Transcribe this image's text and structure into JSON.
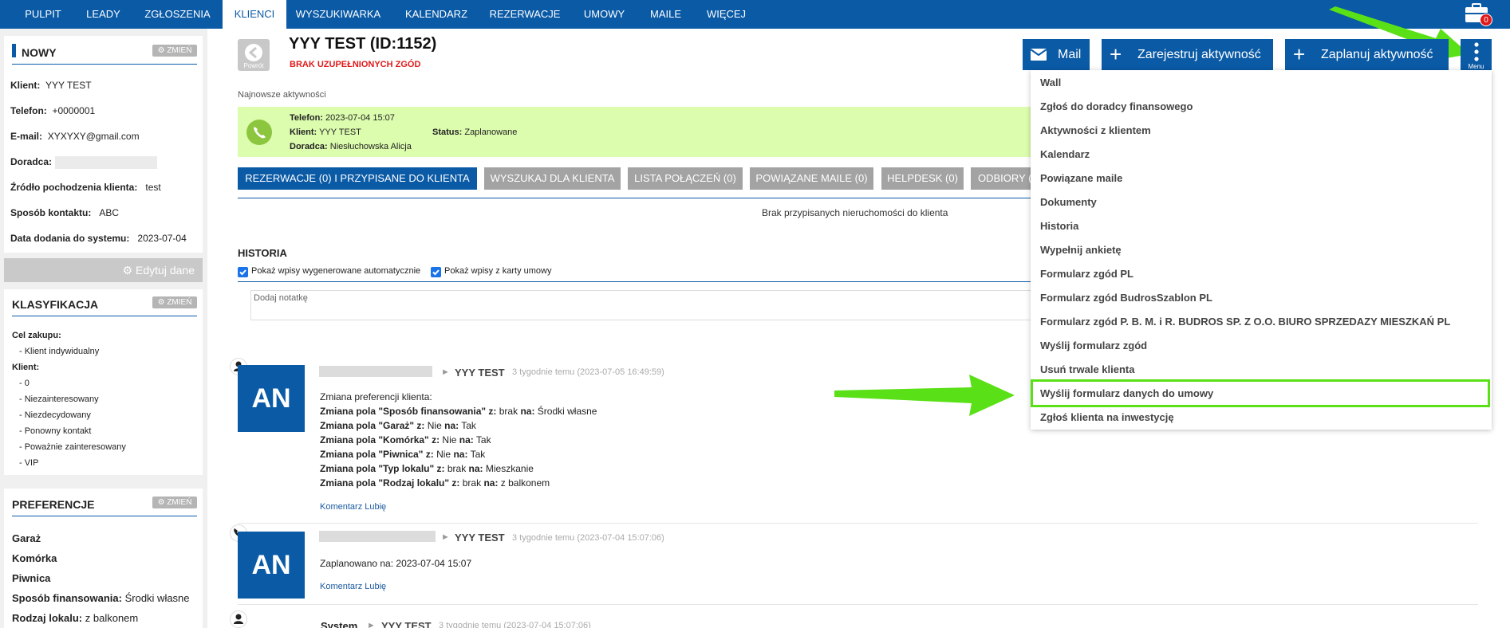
{
  "nav": {
    "items": [
      "PULPIT",
      "LEADY",
      "ZGŁOSZENIA",
      "KLIENCI",
      "WYSZUKIWARKA",
      "KALENDARZ",
      "REZERWACJE",
      "UMOWY",
      "MAILE",
      "WIĘCEJ"
    ],
    "active": "KLIENCI",
    "notifications": "0"
  },
  "sidebar": {
    "status": {
      "title": "NOWY",
      "change_label": "ZMIEŃ"
    },
    "fields": [
      {
        "label": "Klient:",
        "value": "YYY TEST"
      },
      {
        "label": "Telefon:",
        "value": "+0000001"
      },
      {
        "label": "E-mail:",
        "value": "XYXYXY@gmail.com"
      },
      {
        "label": "Doradca:",
        "value": ""
      },
      {
        "label": "Źródło pochodzenia klienta:",
        "value": "test"
      },
      {
        "label": "Sposób kontaktu:",
        "value": "ABC"
      },
      {
        "label": "Data dodania do systemu:",
        "value": "2023-07-04"
      }
    ],
    "edit_label": "Edytuj dane",
    "classification": {
      "title": "KLASYFIKACJA",
      "change_label": "ZMIEŃ",
      "cel_label": "Cel zakupu:",
      "cel_items": [
        "- Klient indywidualny"
      ],
      "klient_label": "Klient:",
      "klient_items": [
        "- 0",
        "- Niezainteresowany",
        "- Niezdecydowany",
        "- Ponowny kontakt",
        "- Poważnie zainteresowany",
        "- VIP"
      ]
    },
    "preferences": {
      "title": "PREFERENCJE",
      "change_label": "ZMIEŃ",
      "items": [
        {
          "label": "Garaż",
          "value": ""
        },
        {
          "label": "Komórka",
          "value": ""
        },
        {
          "label": "Piwnica",
          "value": ""
        },
        {
          "label": "Sposób finansowania:",
          "value": "Środki własne"
        },
        {
          "label": "Rodzaj lokalu:",
          "value": "z balkonem"
        }
      ]
    }
  },
  "header": {
    "back_label": "Powrót",
    "title": "YYY TEST (ID:1152)",
    "consent_warning": "BRAK UZUPEŁNIONYCH ZGÓD",
    "mail_label": "Mail",
    "register_label": "Zarejestruj aktywność",
    "plan_label": "Zaplanuj aktywność",
    "menu_label": "Menu"
  },
  "latest": {
    "section_label": "Najnowsze aktywności",
    "telefon_label": "Telefon:",
    "telefon_value": "2023-07-04 15:07",
    "klient_label": "Klient:",
    "klient_value": "YYY TEST",
    "status_label": "Status:",
    "status_value": "Zaplanowane",
    "doradca_label": "Doradca:",
    "doradca_value": "Niesłuchowska Alicja"
  },
  "tabs": [
    "REZERWACJE (0) I PRZYPISANE DO KLIENTA",
    "WYSZUKAJ DLA KLIENTA",
    "LISTA POŁĄCZEŃ (0)",
    "POWIĄZANE MAILE (0)",
    "HELPDESK (0)",
    "ODBIORY ("
  ],
  "no_properties": "Brak przypisanych nieruchomości do klienta",
  "history": {
    "title": "HISTORIA",
    "check_auto": "Pokaż wpisy wygenerowane automatycznie",
    "check_contract": "Pokaż wpisy z karty umowy",
    "note_placeholder": "Dodaj notatkę",
    "entries": [
      {
        "avatar": "AN",
        "target": "YYY TEST",
        "time": "3 tygodnie temu (2023-07-05 16:49:59)",
        "intro": "Zmiana preferencji klienta:",
        "changes": [
          {
            "field": "Zmiana pola \"Sposób finansowania\" z:",
            "from": "brak",
            "to": "Środki własne"
          },
          {
            "field": "Zmiana pola \"Garaż\" z:",
            "from": "Nie",
            "to": "Tak"
          },
          {
            "field": "Zmiana pola \"Komórka\" z:",
            "from": "Nie",
            "to": "Tak"
          },
          {
            "field": "Zmiana pola \"Piwnica\" z:",
            "from": "Nie",
            "to": "Tak"
          },
          {
            "field": "Zmiana pola \"Typ lokalu\" z:",
            "from": "brak",
            "to": "Mieszkanie"
          },
          {
            "field": "Zmiana pola \"Rodzaj lokalu\" z:",
            "from": "brak",
            "to": "z balkonem"
          }
        ],
        "na_label": "na:",
        "links": "Komentarz Lubię"
      },
      {
        "avatar": "AN",
        "target": "YYY TEST",
        "time": "3 tygodnie temu (2023-07-04 15:07:06)",
        "text": "Zaplanowano na: 2023-07-04 15:07",
        "links": "Komentarz Lubię"
      },
      {
        "author": "System",
        "target": "YYY TEST",
        "time": "3 tygodnie temu (2023-07-04 15:07:06)"
      }
    ]
  },
  "menu": {
    "items": [
      "Wall",
      "Zgłoś do doradcy finansowego",
      "Aktywności z klientem",
      "Kalendarz",
      "Powiązane maile",
      "Dokumenty",
      "Historia",
      "Wypełnij ankietę",
      "Formularz zgód PL",
      "Formularz zgód BudrosSzablon PL",
      "Formularz zgód P. B. M. i R. BUDROS SP. Z O.O. BIURO SPRZEDAZY MIESZKAŃ PL",
      "Wyślij formularz zgód",
      "Usuń trwale klienta",
      "Wyślij formularz danych do umowy",
      "Zgłoś klienta na inwestycję"
    ],
    "highlighted": "Wyślij formularz danych do umowy"
  },
  "colors": {
    "brand": "#0a5aa6",
    "highlight": "#5ae016",
    "latest_bg": "#dcfcae",
    "warning": "#e0191a"
  }
}
